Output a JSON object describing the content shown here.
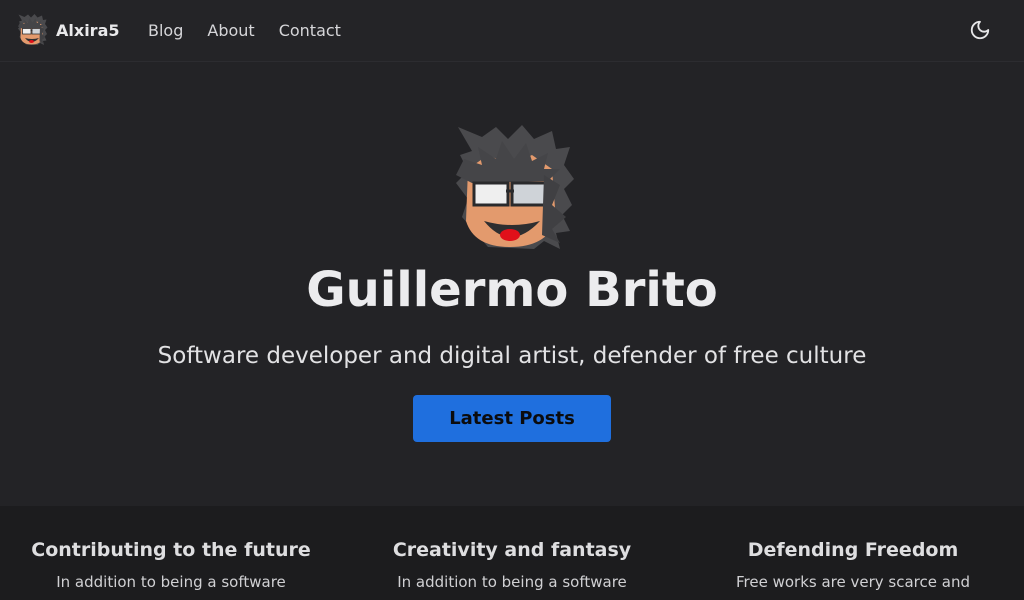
{
  "navbar": {
    "brand": "Alxira5",
    "links": [
      {
        "label": "Blog"
      },
      {
        "label": "About"
      },
      {
        "label": "Contact"
      }
    ],
    "theme_toggle_icon": "moon-icon"
  },
  "hero": {
    "title": "Guillermo Brito",
    "subtitle": "Software developer and digital artist, defender of free culture",
    "button_label": "Latest Posts",
    "button_color": "#1f6fde"
  },
  "features": [
    {
      "title": "Contributing to the future",
      "text": "In addition to being a software"
    },
    {
      "title": "Creativity and fantasy",
      "text": "In addition to being a software"
    },
    {
      "title": "Defending Freedom",
      "text": "Free works are very scarce and"
    }
  ],
  "colors": {
    "background": "#232326",
    "features_background": "#1c1c1e",
    "accent": "#1f6fde"
  }
}
